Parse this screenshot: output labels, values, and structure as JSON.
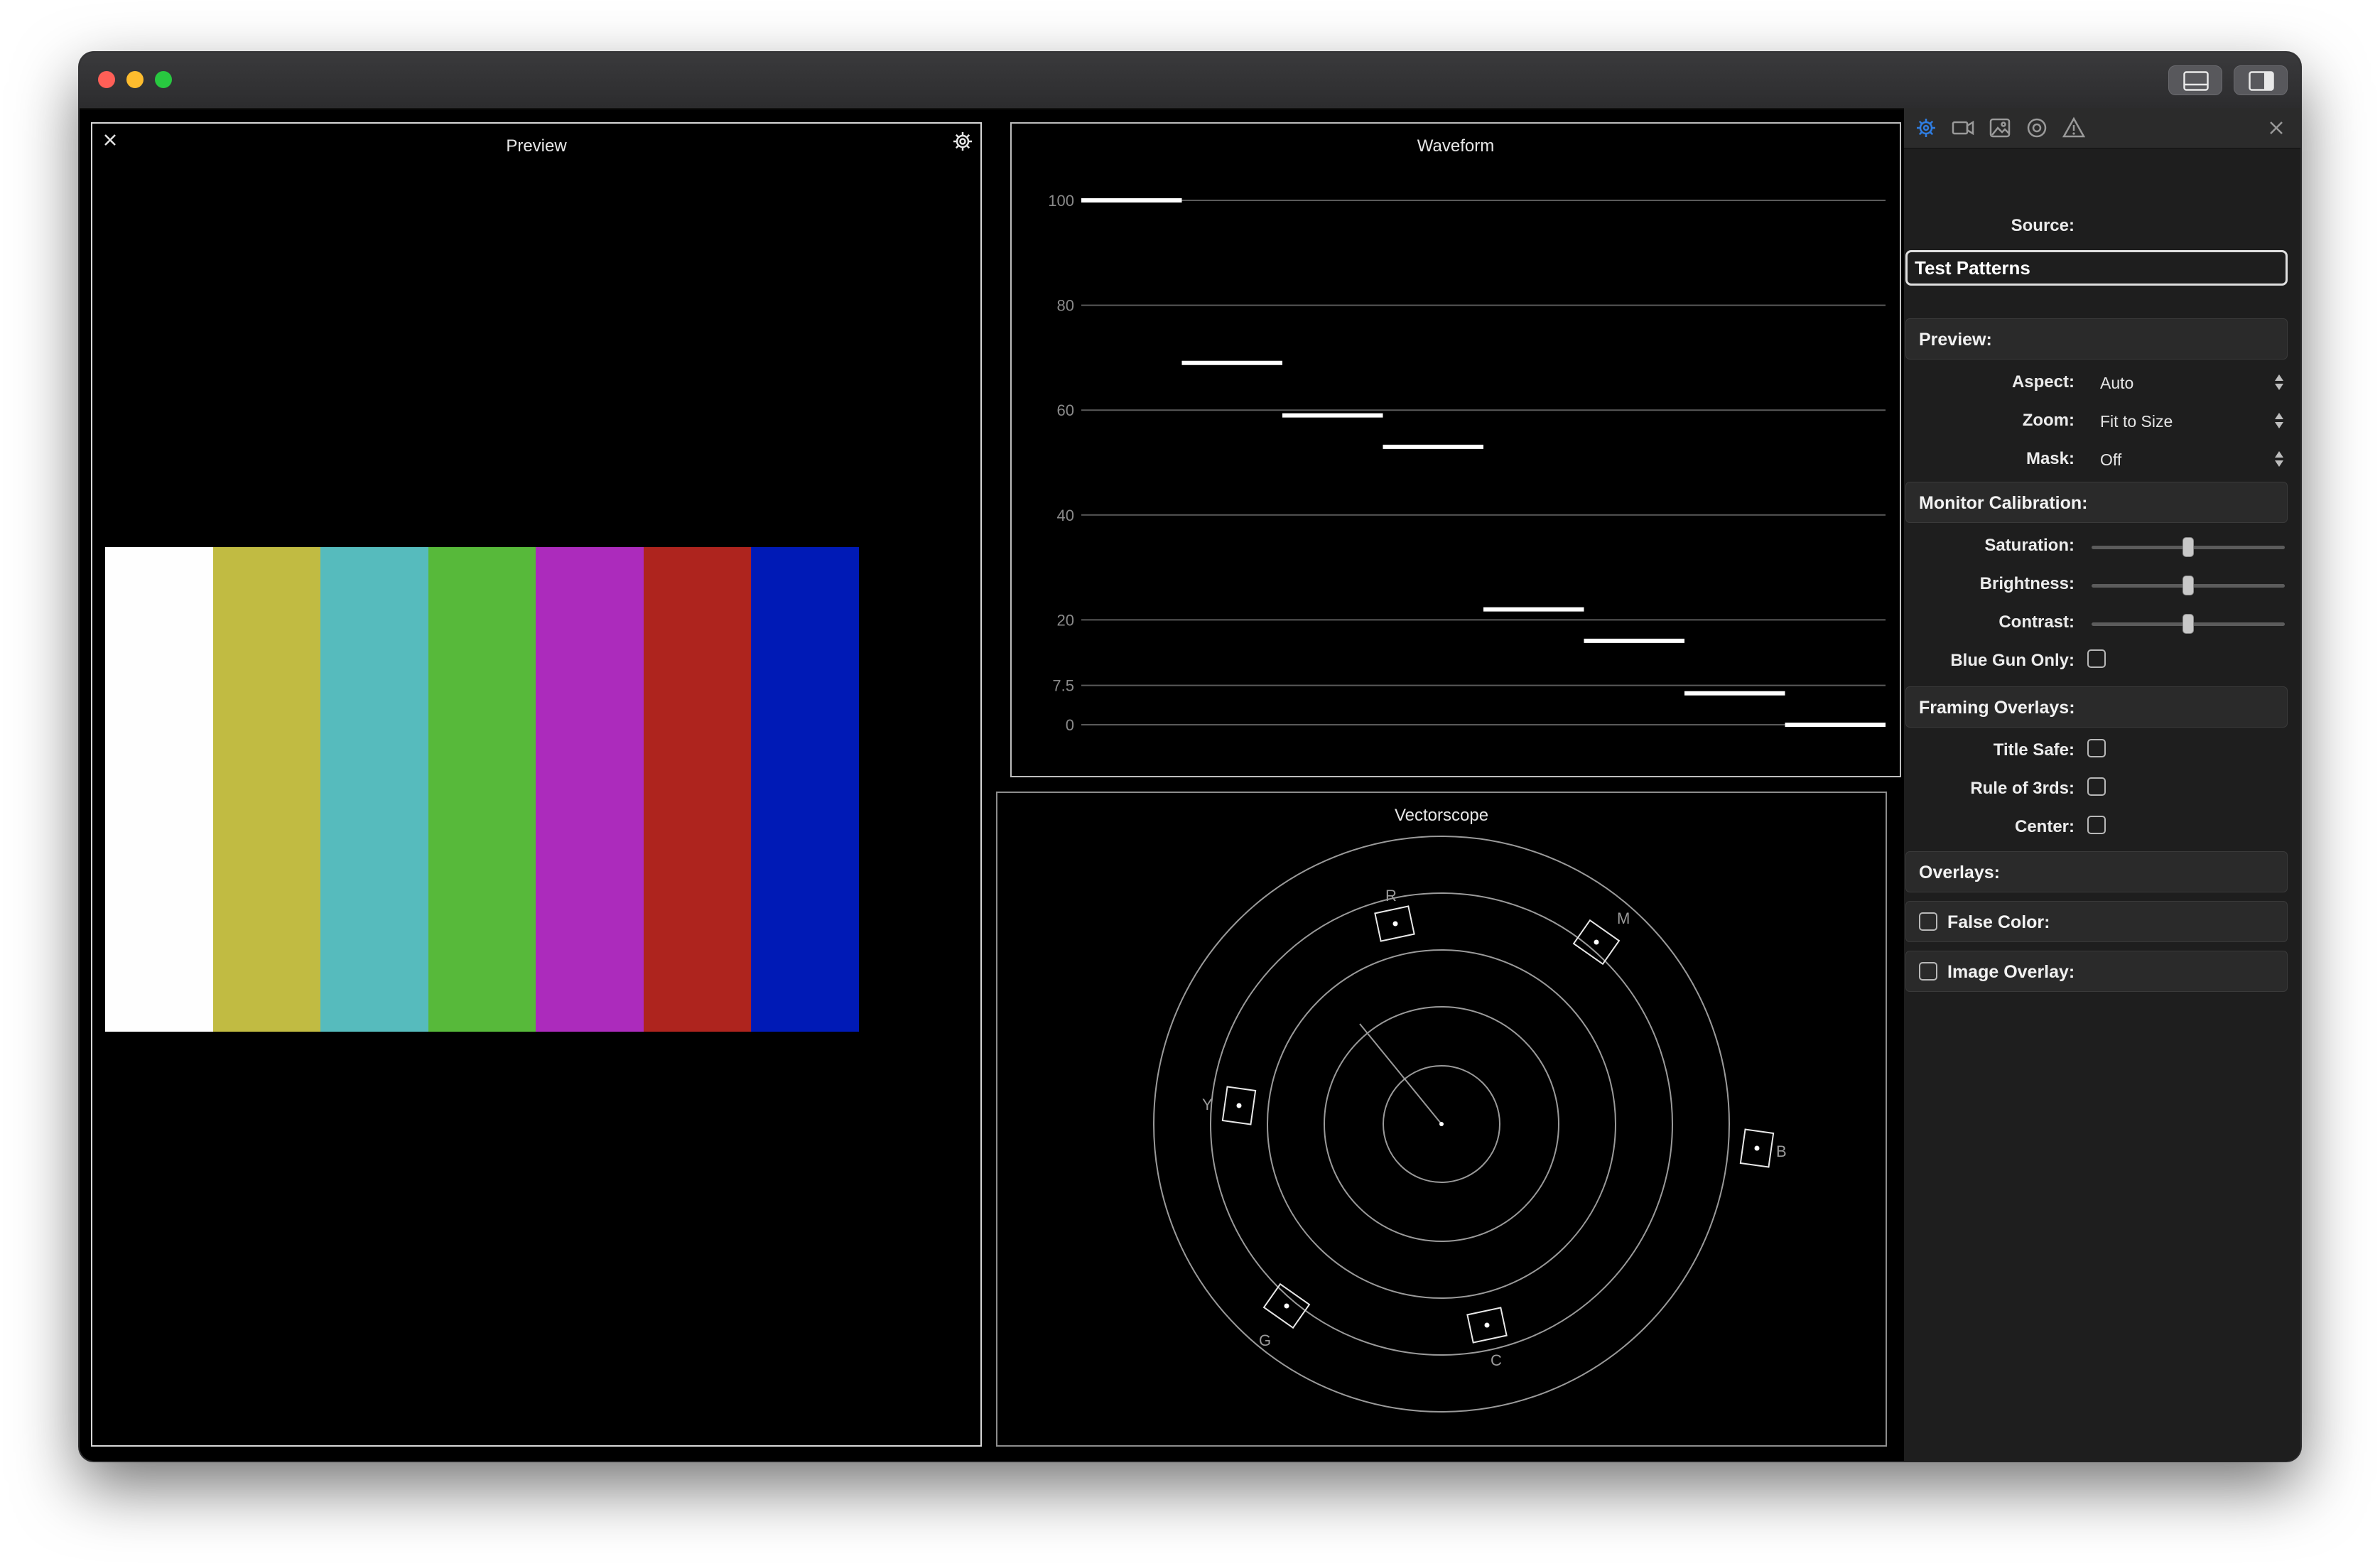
{
  "window": {
    "toolbar": {
      "layout_icon": "panel-bottom-icon",
      "inspector_icon": "sidebar-right-icon"
    }
  },
  "preview": {
    "title": "Preview",
    "bar_colors": [
      "#fefefe",
      "#c1bb42",
      "#56bbbd",
      "#57b93a",
      "#ac2bbc",
      "#ae241e",
      "#001ab6"
    ]
  },
  "waveform": {
    "title": "Waveform",
    "gridlines": [
      "100",
      "80",
      "60",
      "40",
      "20",
      "7.5",
      "0"
    ],
    "chart_data": {
      "type": "line",
      "y_ticks": [
        100,
        80,
        60,
        40,
        20,
        7.5,
        0
      ],
      "ylim": [
        0,
        100
      ],
      "x": [
        "white",
        "yellow",
        "cyan",
        "green",
        "magenta",
        "red",
        "blue",
        "black"
      ],
      "values": [
        100,
        69,
        59,
        53,
        22,
        16,
        6,
        0
      ]
    }
  },
  "vectorscope": {
    "title": "Vectorscope",
    "labels": {
      "R": "R",
      "M": "M",
      "Y": "Y",
      "B": "B",
      "G": "G",
      "C": "C"
    }
  },
  "inspector": {
    "tabs": [
      "settings-icon",
      "camera-icon",
      "image-icon",
      "target-icon",
      "warning-icon"
    ],
    "source_label": "Source:",
    "source_value": "Test Patterns",
    "preview_section": {
      "title": "Preview:",
      "aspect_label": "Aspect:",
      "aspect_value": "Auto",
      "zoom_label": "Zoom:",
      "zoom_value": "Fit to Size",
      "mask_label": "Mask:",
      "mask_value": "Off"
    },
    "calibration_section": {
      "title": "Monitor Calibration:",
      "saturation_label": "Saturation:",
      "saturation": 0.5,
      "brightness_label": "Brightness:",
      "brightness": 0.5,
      "contrast_label": "Contrast:",
      "contrast": 0.5,
      "blue_gun_label": "Blue Gun Only:",
      "blue_gun": false
    },
    "framing_section": {
      "title": "Framing Overlays:",
      "title_safe_label": "Title Safe:",
      "title_safe": false,
      "rule_thirds_label": "Rule of 3rds:",
      "rule_thirds": false,
      "center_label": "Center:",
      "center": false
    },
    "overlays_section": {
      "title": "Overlays:"
    },
    "false_color_label": "False Color:",
    "false_color": false,
    "image_overlay_label": "Image Overlay:",
    "image_overlay": false,
    "accent": "#2f7de1"
  }
}
